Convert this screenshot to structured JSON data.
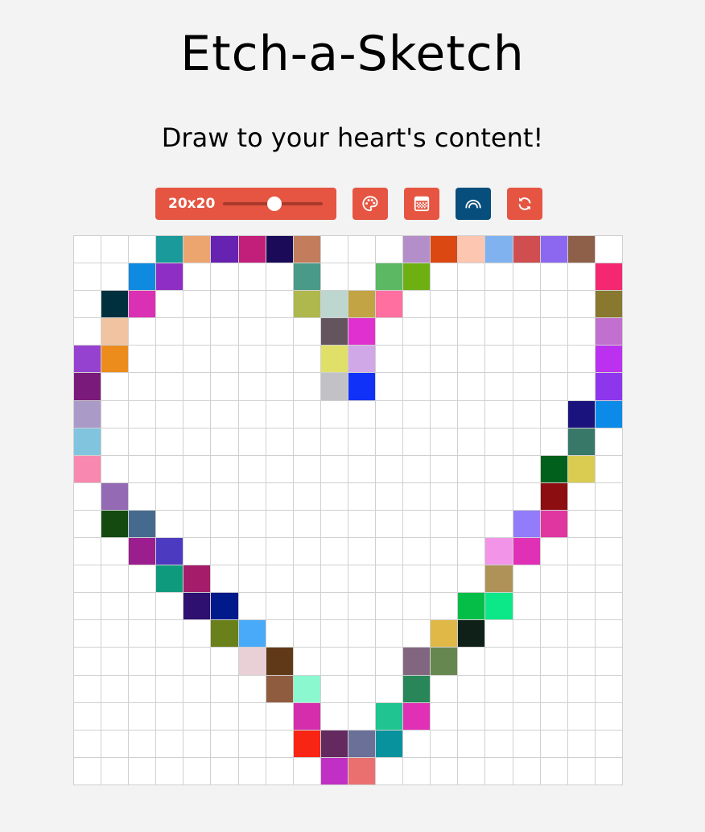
{
  "app": {
    "title": "Etch-a-Sketch",
    "subtitle": "Draw to your heart's content!"
  },
  "controls": {
    "size_label": "20x20",
    "grid_size": 20,
    "slider": {
      "min": 2,
      "max": 64,
      "value": 20
    },
    "buttons": [
      {
        "name": "random-color-button",
        "icon": "palette-icon",
        "active": false
      },
      {
        "name": "shade-button",
        "icon": "grid-shade-icon",
        "active": false
      },
      {
        "name": "rainbow-button",
        "icon": "rainbow-icon",
        "active": true
      },
      {
        "name": "reset-button",
        "icon": "refresh-icon",
        "active": false
      }
    ]
  },
  "colors": {
    "background": "#f3f3f3",
    "accent": "#e55542",
    "active": "#074e7c",
    "grid_line": "#d0d0d0"
  },
  "grid": {
    "rows": 20,
    "cols": 20,
    "cells": [
      [
        0,
        3,
        "#1a9a9a"
      ],
      [
        0,
        4,
        "#eda570"
      ],
      [
        0,
        5,
        "#6622b0"
      ],
      [
        0,
        6,
        "#c21f7a"
      ],
      [
        0,
        7,
        "#1a0a58"
      ],
      [
        0,
        8,
        "#c27d5c"
      ],
      [
        0,
        12,
        "#b48ec8"
      ],
      [
        0,
        13,
        "#db4812"
      ],
      [
        0,
        14,
        "#fcc6b0"
      ],
      [
        0,
        15,
        "#80b2f0"
      ],
      [
        0,
        16,
        "#d04e50"
      ],
      [
        0,
        17,
        "#8c68f0"
      ],
      [
        0,
        18,
        "#8e604a"
      ],
      [
        1,
        2,
        "#0e8ae0"
      ],
      [
        1,
        3,
        "#8e2ec4"
      ],
      [
        1,
        8,
        "#4a9a88"
      ],
      [
        1,
        11,
        "#5cb862"
      ],
      [
        1,
        12,
        "#6eb012"
      ],
      [
        1,
        19,
        "#f42870"
      ],
      [
        2,
        1,
        "#00303e"
      ],
      [
        2,
        2,
        "#da30b4"
      ],
      [
        2,
        8,
        "#aeb84c"
      ],
      [
        2,
        9,
        "#bed6d0"
      ],
      [
        2,
        10,
        "#c2a444"
      ],
      [
        2,
        11,
        "#ff70a0"
      ],
      [
        2,
        19,
        "#887830"
      ],
      [
        3,
        1,
        "#f0c4a0"
      ],
      [
        3,
        9,
        "#64545e"
      ],
      [
        3,
        10,
        "#e030d0"
      ],
      [
        3,
        19,
        "#c270d0"
      ],
      [
        4,
        0,
        "#9642d0"
      ],
      [
        4,
        1,
        "#ec8c1c"
      ],
      [
        4,
        9,
        "#e0e068"
      ],
      [
        4,
        10,
        "#d0a8e8"
      ],
      [
        4,
        19,
        "#bc30f0"
      ],
      [
        5,
        0,
        "#7a1a7a"
      ],
      [
        5,
        9,
        "#c2c2c6"
      ],
      [
        5,
        10,
        "#1032f8"
      ],
      [
        5,
        19,
        "#8e36ec"
      ],
      [
        6,
        0,
        "#aa9ac8"
      ],
      [
        6,
        18,
        "#1a137e"
      ],
      [
        6,
        19,
        "#0c8ae8"
      ],
      [
        7,
        0,
        "#80c4de"
      ],
      [
        7,
        18,
        "#387868"
      ],
      [
        8,
        0,
        "#f888b0"
      ],
      [
        8,
        17,
        "#00601c"
      ],
      [
        8,
        18,
        "#dacc50"
      ],
      [
        9,
        1,
        "#946ab4"
      ],
      [
        9,
        17,
        "#8c0e10"
      ],
      [
        10,
        1,
        "#144a10"
      ],
      [
        10,
        2,
        "#466a8e"
      ],
      [
        10,
        16,
        "#927cfa"
      ],
      [
        10,
        17,
        "#e036a0"
      ],
      [
        11,
        2,
        "#9c1e8e"
      ],
      [
        11,
        3,
        "#4c3ac0"
      ],
      [
        11,
        15,
        "#f294e8"
      ],
      [
        11,
        16,
        "#e030b6"
      ],
      [
        12,
        3,
        "#0e9a7c"
      ],
      [
        12,
        4,
        "#a41c6a"
      ],
      [
        12,
        15,
        "#ae9258"
      ],
      [
        13,
        4,
        "#2e1070"
      ],
      [
        13,
        5,
        "#001a8c"
      ],
      [
        13,
        14,
        "#04be48"
      ],
      [
        13,
        15,
        "#0ce888"
      ],
      [
        14,
        5,
        "#6a801a"
      ],
      [
        14,
        6,
        "#48aaf8"
      ],
      [
        14,
        13,
        "#e0b848"
      ],
      [
        14,
        14,
        "#0e2018"
      ],
      [
        15,
        6,
        "#e8d0d6"
      ],
      [
        15,
        7,
        "#603a18"
      ],
      [
        15,
        12,
        "#826680"
      ],
      [
        15,
        13,
        "#668850"
      ],
      [
        16,
        7,
        "#905c40"
      ],
      [
        16,
        8,
        "#8cf8d0"
      ],
      [
        16,
        12,
        "#288658"
      ],
      [
        17,
        8,
        "#d42eac"
      ],
      [
        17,
        11,
        "#20c490"
      ],
      [
        17,
        12,
        "#e030b6"
      ],
      [
        18,
        8,
        "#f82414"
      ],
      [
        18,
        9,
        "#642a60"
      ],
      [
        18,
        10,
        "#6a7098"
      ],
      [
        18,
        11,
        "#08929e"
      ],
      [
        19,
        9,
        "#c030c4"
      ],
      [
        19,
        10,
        "#ea7070"
      ]
    ]
  }
}
